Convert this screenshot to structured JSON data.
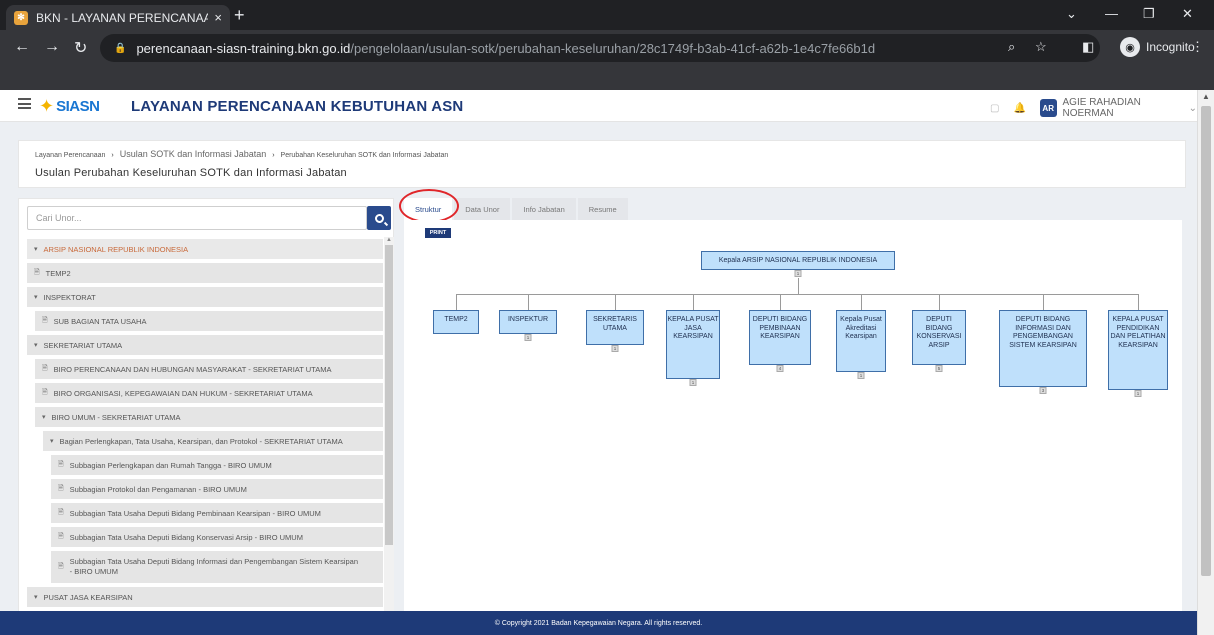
{
  "browser": {
    "tab_title": "BKN - LAYANAN PERENCANAAN",
    "tab_close": "×",
    "new_tab": "+",
    "url_host": "perencanaan-siasn-training.bkn.go.id",
    "url_path": "/pengelolaan/usulan-sotk/perubahan-keseluruhan/28c1749f-b3ab-41cf-a62b-1e4c7fe66b1d",
    "incognito_label": "Incognito",
    "win_min": "—",
    "win_max": "❐",
    "win_close": "✕",
    "win_chevron": "⌄"
  },
  "app": {
    "logo_text": "SIASN",
    "title": "LAYANAN PERENCANAAN KEBUTUHAN ASN",
    "user_initials": "AR",
    "user_name": "AGIE RAHADIAN NOERMAN"
  },
  "breadcrumb": {
    "item1": "Layanan Perencanaan",
    "item2": "Usulan SOTK dan Informasi Jabatan",
    "item3": "Perubahan Keseluruhan SOTK dan Informasi Jabatan",
    "sep": "›"
  },
  "page_title": "Usulan Perubahan Keseluruhan SOTK dan Informasi Jabatan",
  "search": {
    "placeholder": "Cari Unor..."
  },
  "tree": [
    {
      "label": "ARSIP NASIONAL REPUBLIK INDONESIA",
      "icon": "▾"
    },
    {
      "label": "TEMP2",
      "icon": "🗎"
    },
    {
      "label": "INSPEKTORAT",
      "icon": "▾"
    },
    {
      "label": "SUB BAGIAN TATA USAHA",
      "icon": "🗎"
    },
    {
      "label": "SEKRETARIAT UTAMA",
      "icon": "▾"
    },
    {
      "label": "BIRO PERENCANAAN DAN HUBUNGAN MASYARAKAT - SEKRETARIAT UTAMA",
      "icon": "🗎"
    },
    {
      "label": "BIRO ORGANISASI, KEPEGAWAIAN DAN HUKUM - SEKRETARIAT UTAMA",
      "icon": "🗎"
    },
    {
      "label": "BIRO UMUM - SEKRETARIAT UTAMA",
      "icon": "▾"
    },
    {
      "label": "Bagian Perlengkapan, Tata Usaha, Kearsipan, dan Protokol - SEKRETARIAT UTAMA",
      "icon": "▾"
    },
    {
      "label": "Subbagian Perlengkapan dan Rumah Tangga - BIRO UMUM",
      "icon": "🗎"
    },
    {
      "label": "Subbagian Protokol dan Pengamanan - BIRO UMUM",
      "icon": "🗎"
    },
    {
      "label": "Subbagian Tata Usaha Deputi Bidang Pembinaan Kearsipan - BIRO UMUM",
      "icon": "🗎"
    },
    {
      "label": "Subbagian Tata Usaha Deputi Bidang Konservasi Arsip - BIRO UMUM",
      "icon": "🗎"
    },
    {
      "label": "Subbagian Tata Usaha Deputi Bidang Informasi dan Pengembangan Sistem Kearsipan - BIRO UMUM",
      "icon": "🗎"
    },
    {
      "label": "PUSAT JASA KEARSIPAN",
      "icon": "▾"
    }
  ],
  "tabs": [
    "Struktur",
    "Data Unor",
    "Info Jabatan",
    "Resume"
  ],
  "print_label": "PRINT",
  "org": {
    "root": {
      "label": "Kepala ARSIP NASIONAL REPUBLIK INDONESIA",
      "count": "1"
    },
    "children": [
      {
        "label": "TEMP2",
        "count": ""
      },
      {
        "label": "INSPEKTUR",
        "count": "1"
      },
      {
        "label": "SEKRETARIS UTAMA",
        "count": "1"
      },
      {
        "label": "KEPALA PUSAT JASA KEARSIPAN",
        "count": "1"
      },
      {
        "label": "DEPUTI BIDANG PEMBINAAN KEARSIPAN",
        "count": "4"
      },
      {
        "label": "Kepala Pusat Akreditasi Kearsipan",
        "count": "1"
      },
      {
        "label": "DEPUTI BIDANG KONSERVASI ARSIP",
        "count": "5"
      },
      {
        "label": "DEPUTI BIDANG INFORMASI DAN PENGEMBANGAN SISTEM KEARSIPAN",
        "count": "3"
      },
      {
        "label": "KEPALA PUSAT PENDIDIKAN DAN PELATIHAN KEARSIPAN",
        "count": "1"
      }
    ]
  },
  "footer": "© Copyright 2021 Badan Kepegawaian Negara. All rights reserved."
}
